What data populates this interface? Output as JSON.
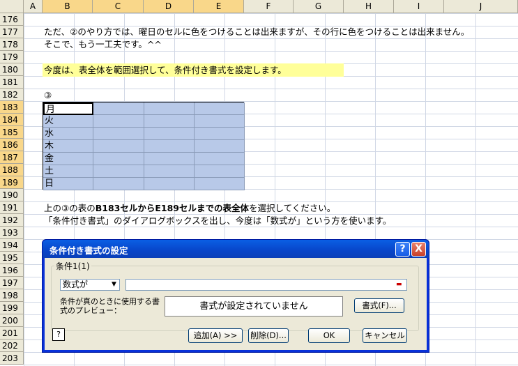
{
  "columns": [
    "A",
    "B",
    "C",
    "D",
    "E",
    "F",
    "G",
    "H",
    "I",
    "J"
  ],
  "rows": [
    "176",
    "177",
    "178",
    "179",
    "180",
    "181",
    "182",
    "183",
    "184",
    "185",
    "186",
    "187",
    "188",
    "189",
    "190",
    "191",
    "192",
    "193",
    "194",
    "195",
    "196",
    "197",
    "198",
    "199",
    "200",
    "201",
    "202",
    "203"
  ],
  "texts": {
    "r177": "ただ、②のやり方では、曜日のセルに色をつけることは出来ますが、その行に色をつけることは出来ません。",
    "r178": "そこで、もう一工夫です。^^",
    "r180": "今度は、表全体を範囲選択して、条件付き書式を設定します。",
    "r182": "③",
    "r191_a": "上の③の表の",
    "r191_b": "B183セルからE189セルまでの表全体",
    "r191_c": "を選択してください。",
    "r192": "「条件付き書式」のダイアログボックスを出し、今度は「数式が」という方を使います。"
  },
  "table": {
    "days": [
      "月",
      "火",
      "水",
      "木",
      "金",
      "土",
      "日"
    ]
  },
  "dialog": {
    "title": "条件付き書式の設定",
    "help_btn": "?",
    "close_btn": "X",
    "condition_label": "条件1(1)",
    "condition_type": "数式が",
    "preview_label": "条件が真のときに使用する書式のプレビュー：",
    "preview_text": "書式が設定されていません",
    "format_btn": "書式(F)...",
    "add_btn": "追加(A) >>",
    "delete_btn": "削除(D)...",
    "ok_btn": "OK",
    "cancel_btn": "キャンセル",
    "help_icon": "?"
  },
  "colors": {
    "selection": "#b8c9e8",
    "highlight": "#ffff99",
    "header_selected": "#f9d78a",
    "dialog_frame": "#0831d9"
  }
}
